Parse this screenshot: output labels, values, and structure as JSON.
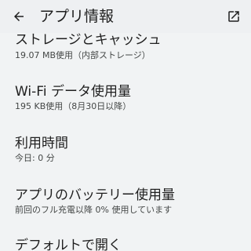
{
  "appbar": {
    "title": "アプリ情報",
    "back_icon": "arrow-back-icon",
    "open_icon": "open-in-new-icon"
  },
  "items": [
    {
      "title": "ストレージとキャッシュ",
      "summary": "19.07 MB使用（内部ストレージ）"
    },
    {
      "title": "Wi-Fi データ使用量",
      "summary": "195 KB使用（8月30日以降）"
    },
    {
      "title": "利用時間",
      "summary": "今日: 0 分"
    },
    {
      "title": "アプリのバッテリー使用量",
      "summary": "前回のフル充電以降 0% 使用しています"
    },
    {
      "title": "デフォルトで開く",
      "summary": ""
    }
  ],
  "colors": {
    "background": "#f1f3f4",
    "appbar": "#eef0f2",
    "text_primary": "#1f1f1f",
    "text_secondary": "#444746"
  }
}
